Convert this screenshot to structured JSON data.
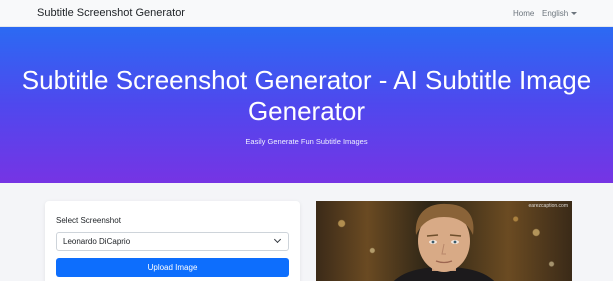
{
  "navbar": {
    "brand": "Subtitle Screenshot Generator",
    "home": "Home",
    "language": "English"
  },
  "hero": {
    "title": "Subtitle Screenshot Generator - AI Subtitle Image Generator",
    "subtitle": "Easily Generate Fun Subtitle Images"
  },
  "form": {
    "select_label": "Select Screenshot",
    "selected_value": "Leonardo DiCaprio",
    "upload_button": "Upload Image"
  },
  "preview": {
    "watermark": "earezcaption.com"
  },
  "colors": {
    "hero_top": "#2b6af3",
    "hero_bottom": "#7634e4",
    "button": "#0d6efd"
  }
}
